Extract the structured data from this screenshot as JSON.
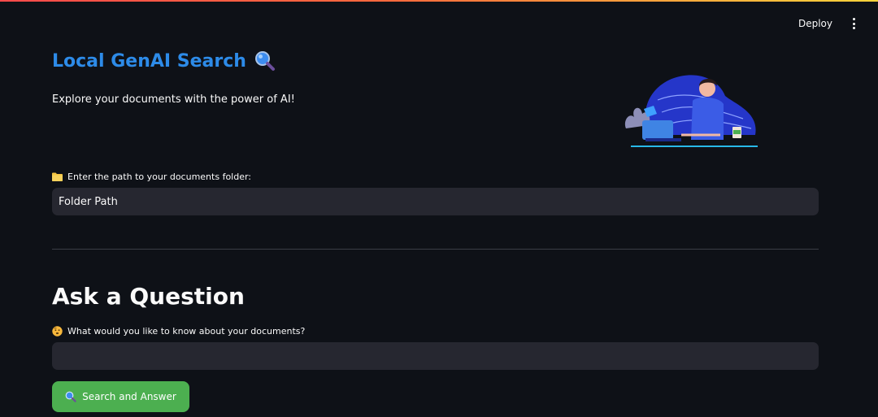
{
  "header": {
    "deploy_label": "Deploy"
  },
  "hero": {
    "title": "Local GenAI Search",
    "subtitle": "Explore your documents with the power of AI!"
  },
  "folder_field": {
    "label": "Enter the path to your documents folder:",
    "placeholder": "Folder Path",
    "value": ""
  },
  "question_section": {
    "heading": "Ask a Question",
    "label": "What would you like to know about your documents?",
    "value": ""
  },
  "search_button": {
    "label": "Search and Answer"
  },
  "icons": {
    "title_icon": "magnifier-icon",
    "folder_icon": "folder-icon",
    "question_icon": "thinking-face-icon",
    "button_icon": "magnifier-icon",
    "menu_icon": "kebab-menu-icon"
  },
  "colors": {
    "background": "#0e1117",
    "title": "#2d8be8",
    "input_bg": "#262730",
    "button_bg": "#4caf50",
    "top_bar_start": "#ff4b4b",
    "top_bar_end": "#ffd43b"
  }
}
